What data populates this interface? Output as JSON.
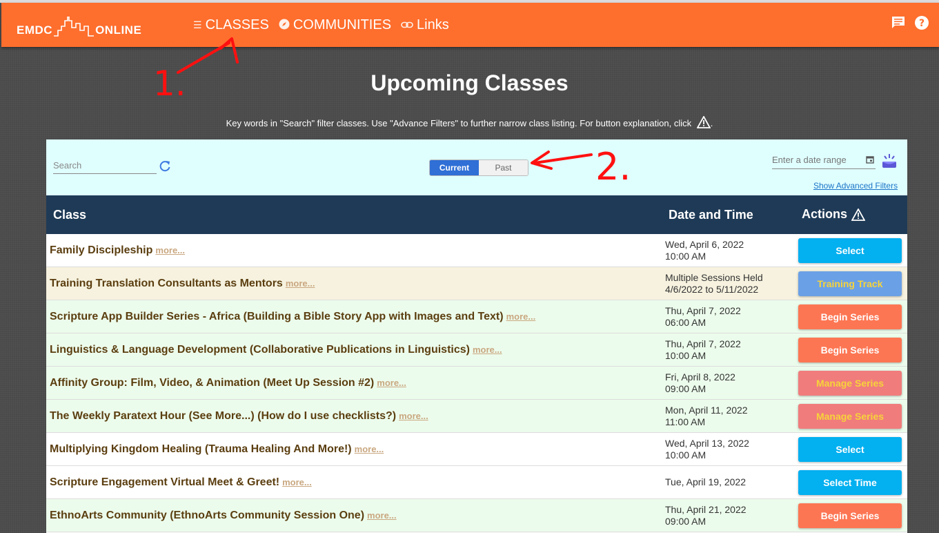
{
  "header": {
    "logo_left": "EMDC",
    "logo_right": "ONLINE",
    "nav": [
      {
        "label": "CLASSES",
        "icon": "list-icon"
      },
      {
        "label": "COMMUNITIES",
        "icon": "compass-icon"
      },
      {
        "label": "Links",
        "icon": "link-icon"
      }
    ],
    "icons": [
      "chat-icon",
      "help-icon"
    ]
  },
  "page": {
    "title": "Upcoming Classes",
    "subtitle": "Key words in \"Search\" filter classes. Use \"Advance Filters\" to further narrow class listing. For button explanation, click",
    "subtitle_end": "."
  },
  "filters": {
    "search_placeholder": "Search",
    "toggle_current": "Current",
    "toggle_past": "Past",
    "date_placeholder": "Enter a date range",
    "advanced_link": "Show Advanced Filters"
  },
  "table": {
    "col_class": "Class",
    "col_datetime": "Date and Time",
    "col_actions": "Actions",
    "more_label": "more...",
    "rows": [
      {
        "title": "Family Discipleship",
        "date": "Wed, April 6, 2022",
        "time": "10:00 AM",
        "action": "Select",
        "bg": "#ffffff",
        "btn_bg": "#03b0f0",
        "btn_fg": "#ffffff"
      },
      {
        "title": "Training Translation Consultants as Mentors",
        "date": "Multiple Sessions Held",
        "time": "4/6/2022 to 5/11/2022",
        "action": "Training Track",
        "bg": "#f6f2df",
        "btn_bg": "#6aa0e6",
        "btn_fg": "#f7d33a"
      },
      {
        "title": "Scripture App Builder Series - Africa (Building a Bible Story App with Images and Text)",
        "date": "Thu, April 7, 2022",
        "time": "06:00 AM",
        "action": "Begin Series",
        "bg": "#ecfcec",
        "btn_bg": "#fd7653",
        "btn_fg": "#ffffff"
      },
      {
        "title": "Linguistics & Language Development (Collaborative Publications in Linguistics)",
        "date": "Thu, April 7, 2022",
        "time": "10:00 AM",
        "action": "Begin Series",
        "bg": "#ecfcec",
        "btn_bg": "#fd7653",
        "btn_fg": "#ffffff"
      },
      {
        "title": "Affinity Group: Film, Video, & Animation (Meet Up Session #2)",
        "date": "Fri, April 8, 2022",
        "time": "09:00 AM",
        "action": "Manage Series",
        "bg": "#ecfcec",
        "btn_bg": "#f07c7c",
        "btn_fg": "#f7d33a"
      },
      {
        "title": "The Weekly Paratext Hour (See More...) (How do I use checklists?)",
        "date": "Mon, April 11, 2022",
        "time": "11:00 AM",
        "action": "Manage Series",
        "bg": "#ecfcec",
        "btn_bg": "#f07c7c",
        "btn_fg": "#f7d33a"
      },
      {
        "title": "Multiplying Kingdom Healing (Trauma Healing And More!)",
        "date": "Wed, April 13, 2022",
        "time": "10:00 AM",
        "action": "Select",
        "bg": "#ffffff",
        "btn_bg": "#03b0f0",
        "btn_fg": "#ffffff"
      },
      {
        "title": "Scripture Engagement Virtual Meet & Greet!",
        "date": "Tue, April 19, 2022",
        "time": "",
        "action": "Select Time",
        "bg": "#ffffff",
        "btn_bg": "#03b0f0",
        "btn_fg": "#ffffff"
      },
      {
        "title": "EthnoArts Community (EthnoArts Community Session One)",
        "date": "Thu, April 21, 2022",
        "time": "09:00 AM",
        "action": "Begin Series",
        "bg": "#ecfcec",
        "btn_bg": "#fd7653",
        "btn_fg": "#ffffff"
      }
    ]
  },
  "annotations": [
    "1.",
    "2."
  ],
  "colors": {
    "header": "#fe6e2d",
    "table_head": "#1e3a56",
    "filter_bg": "#dffefe",
    "annotation": "#ff0000"
  }
}
